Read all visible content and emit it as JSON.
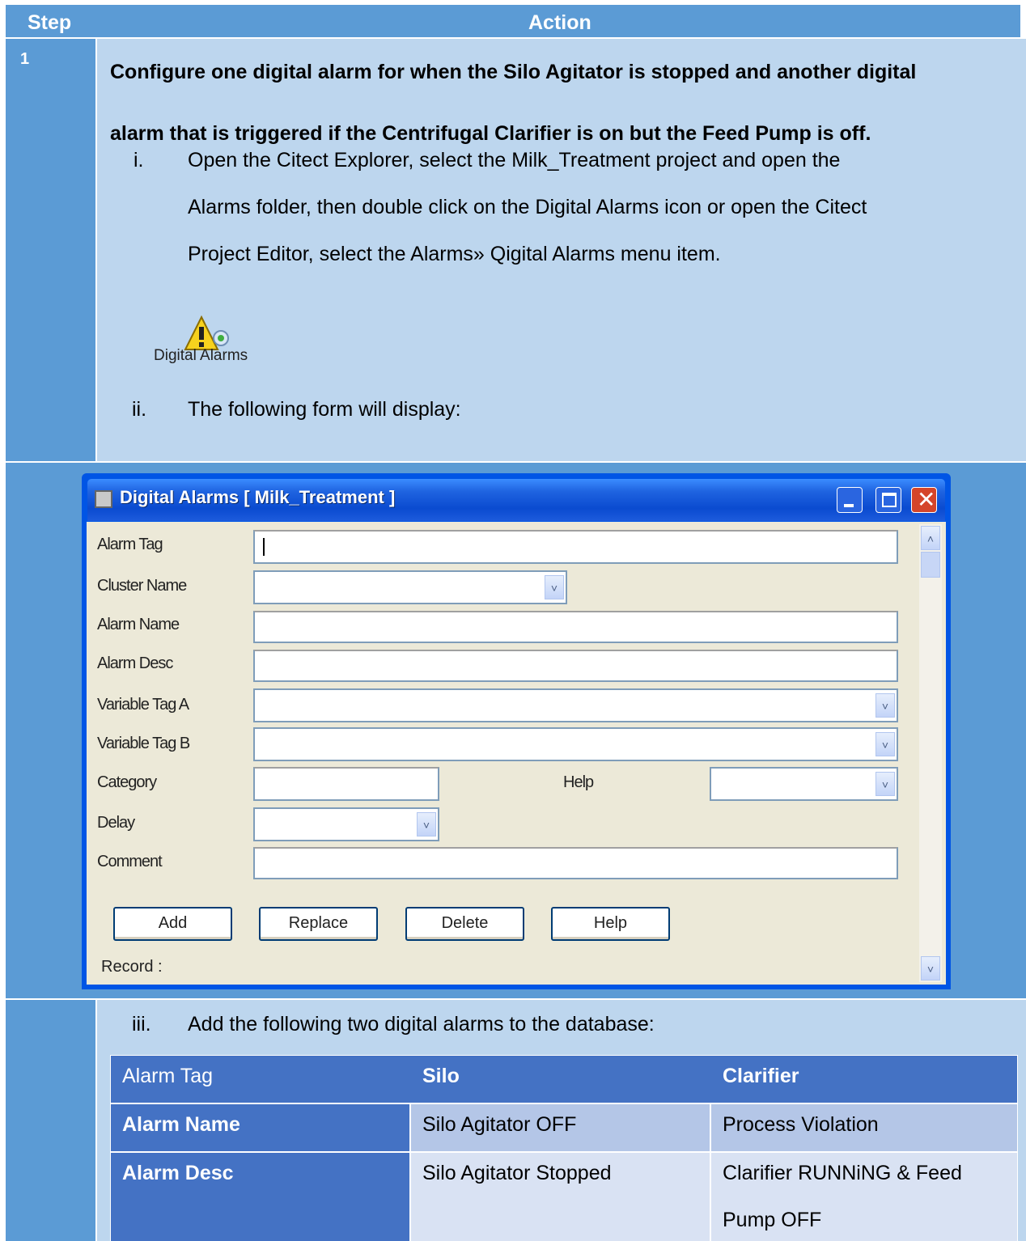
{
  "header": {
    "step_label": "Step",
    "action_label": "Action"
  },
  "step1": {
    "number": "1",
    "heading": "Configure one digital alarm for when the Silo Agitator is stopped and another digital alarm that is triggered if the Centrifugal Clarifier is on but the Feed Pump is off.",
    "heading_line1": "Configure one digital alarm for when the Silo Agitator is stopped and another digital",
    "heading_line2": "alarm that is triggered if the Centrifugal Clarifier is on but the Feed Pump is off.",
    "item_i_marker": "i.",
    "item_i_line1": "Open the Citect Explorer, select the Milk_Treatment project and open the",
    "item_i_line2": "Alarms folder, then double click on the Digital Alarms icon or open the Citect",
    "item_i_line3": "Project Editor, select the Alarms» Qigital Alarms menu item.",
    "icon_label": "Digital Alarms",
    "item_ii_marker": "ii.",
    "item_ii_text": "The following form will display:",
    "item_iii_marker": "iii.",
    "item_iii_text": "Add the following two digital alarms to the database:"
  },
  "dialog": {
    "title": "Digital Alarms [ Milk_Treatment ]",
    "fields": {
      "alarm_tag": "Alarm Tag",
      "cluster_name": "Cluster Name",
      "alarm_name": "Alarm Name",
      "alarm_desc": "Alarm Desc",
      "variable_tag_a": "Variable Tag A",
      "variable_tag_b": "Variable Tag B",
      "category": "Category",
      "help": "Help",
      "delay": "Delay",
      "comment": "Comment"
    },
    "buttons": {
      "add": "Add",
      "replace": "Replace",
      "delete": "Delete",
      "help": "Help"
    },
    "record_label": "Record :"
  },
  "alarm_table": {
    "columns": [
      "Alarm Tag",
      "Silo",
      "Clarifier"
    ],
    "rows": [
      {
        "label": "Alarm Name",
        "silo": "Silo Agitator OFF",
        "clarifier": "Process Violation"
      },
      {
        "label": "Alarm Desc",
        "silo": "Silo Agitator Stopped",
        "clarifier_line1": "Clarifier RUNNiNG & Feed",
        "clarifier_line2": "Pump OFF"
      }
    ]
  },
  "colors": {
    "header_blue": "#5B9BD5",
    "light_blue": "#BDD6EE",
    "table_header": "#4472C4",
    "table_light": "#B4C6E7",
    "table_lighter": "#D9E2F3"
  }
}
